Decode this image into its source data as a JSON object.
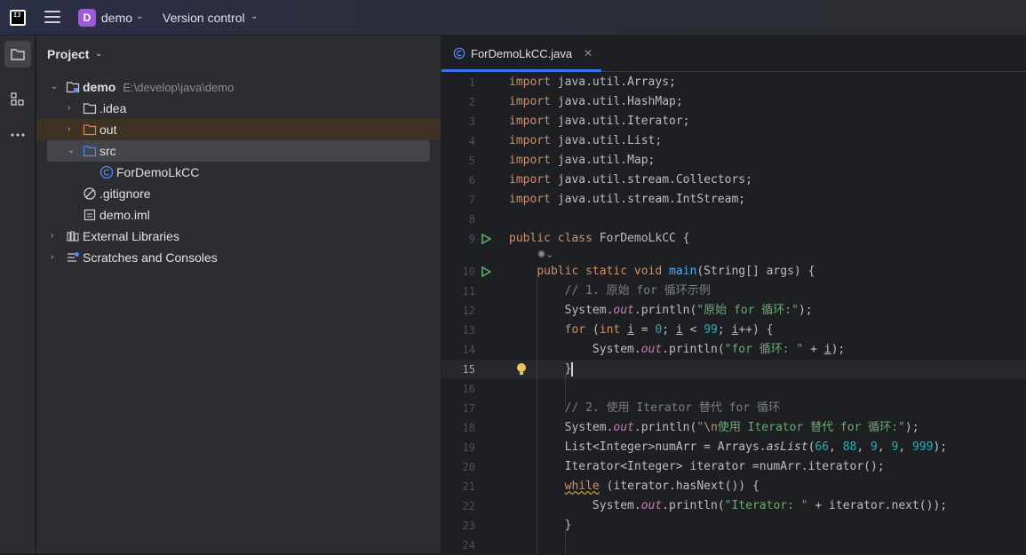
{
  "titlebar": {
    "project_badge": "D",
    "project_name": "demo",
    "vcs_label": "Version control"
  },
  "project_panel": {
    "title": "Project",
    "tree": [
      {
        "label": "demo",
        "path": "E:\\develop\\java\\demo",
        "expanded": true,
        "icon": "module-folder-icon"
      },
      {
        "label": ".idea",
        "expanded": false,
        "icon": "folder-icon"
      },
      {
        "label": "out",
        "expanded": false,
        "icon": "excluded-folder-icon"
      },
      {
        "label": "src",
        "expanded": true,
        "icon": "source-folder-icon"
      },
      {
        "label": "ForDemoLkCC",
        "icon": "java-class-icon"
      },
      {
        "label": ".gitignore",
        "icon": "ignore-file-icon"
      },
      {
        "label": "demo.iml",
        "icon": "iml-file-icon"
      },
      {
        "label": "External Libraries",
        "expanded": false,
        "icon": "libraries-icon"
      },
      {
        "label": "Scratches and Consoles",
        "expanded": false,
        "icon": "scratches-icon"
      }
    ]
  },
  "editor": {
    "tab_label": "ForDemoLkCC.java",
    "current_line": 15,
    "line_numbers": [
      "1",
      "2",
      "3",
      "4",
      "5",
      "6",
      "7",
      "8",
      "9",
      "10",
      "11",
      "12",
      "13",
      "14",
      "15",
      "16",
      "17",
      "18",
      "19",
      "20",
      "21",
      "22",
      "23",
      "24"
    ],
    "code": {
      "l1": "java.util.Arrays;",
      "l2": "java.util.HashMap;",
      "l3": "java.util.Iterator;",
      "l4": "java.util.List;",
      "l5": "java.util.Map;",
      "l6": "java.util.stream.Collectors;",
      "l7": "java.util.stream.IntStream;",
      "kw_import": "import",
      "class_name": "ForDemoLkCC",
      "main_name": "main",
      "main_params": "(String[] args) {",
      "comment1": "// 1. 原始 for 循环示例",
      "str1": "\"原始 for 循环:\"",
      "str2": "\"for 循环: \"",
      "comment2": "// 2. 使用 Iterator 替代 for 循环",
      "str3_esc": "\\n",
      "str3": "使用 Iterator 替代 for 循环:\"",
      "str4": "\"Iterator: \""
    }
  },
  "colors": {
    "accent": "#3574f0",
    "keyword": "#cf8e6d",
    "string": "#6aab73",
    "number": "#2aacb8",
    "comment": "#7a7e85",
    "function": "#56a8f5",
    "static_field": "#c77dbb"
  }
}
